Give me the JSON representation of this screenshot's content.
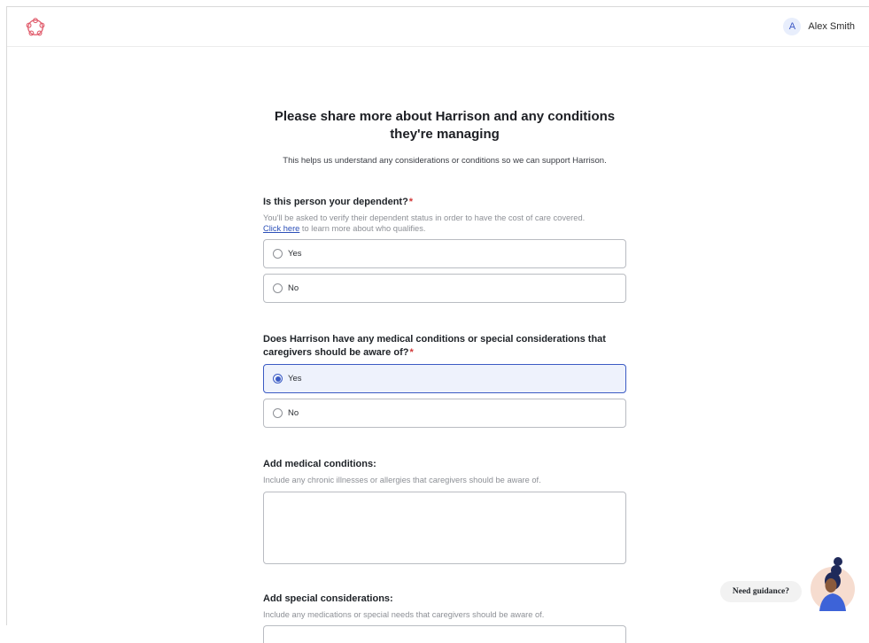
{
  "header": {
    "user": {
      "initial": "A",
      "name": "Alex Smith"
    }
  },
  "page": {
    "title_line1": "Please share more about Harrison and any conditions",
    "title_line2": "they're managing",
    "subtitle": "This helps us understand any considerations or conditions so we can support Harrison."
  },
  "q1": {
    "label": "Is this person your dependent?",
    "required_mark": "*",
    "hint_line1": "You'll be asked to verify their dependent status in order to have the cost of care covered.",
    "hint_link": "Click here",
    "hint_rest": " to learn more about who qualifies.",
    "options": [
      {
        "label": "Yes",
        "selected": false
      },
      {
        "label": "No",
        "selected": false
      }
    ]
  },
  "q2": {
    "label_line1": "Does Harrison have any medical conditions or special considerations that",
    "label_line2": "caregivers should be aware of?",
    "required_mark": "*",
    "options": [
      {
        "label": "Yes",
        "selected": true
      },
      {
        "label": "No",
        "selected": false
      }
    ]
  },
  "medical": {
    "label": "Add medical conditions:",
    "hint": "Include any chronic illnesses or allergies that caregivers should be aware of.",
    "value": ""
  },
  "special": {
    "label": "Add special considerations:",
    "hint": "Include any medications or special needs that caregivers should be aware of."
  },
  "guidance": {
    "label": "Need guidance?"
  },
  "colors": {
    "accent": "#3b5bc4",
    "required": "#d23838",
    "logo": "#e05a6a"
  }
}
